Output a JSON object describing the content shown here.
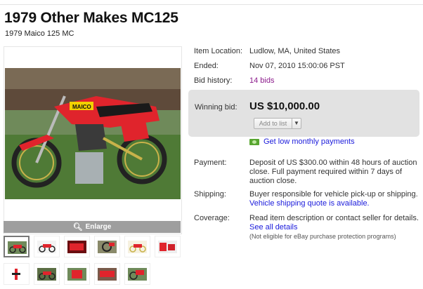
{
  "header": {
    "title": "1979 Other Makes MC125",
    "subtitle": "1979 Maico 125 MC"
  },
  "gallery": {
    "enlarge_label": "Enlarge",
    "thumbnail_count": 11
  },
  "details": {
    "item_location": {
      "label": "Item Location:",
      "value": "Ludlow, MA, United States"
    },
    "ended": {
      "label": "Ended:",
      "value": "Nov 07, 2010 15:00:06 PST"
    },
    "bid_history": {
      "label": "Bid history:",
      "value": "14 bids"
    },
    "winning_bid": {
      "label": "Winning bid:",
      "value": "US $10,000.00"
    },
    "add_to_list": "Add to list",
    "monthly_payments": "Get low monthly payments",
    "payment": {
      "label": "Payment:",
      "line1": "Deposit of US $300.00 within 48 hours of auction",
      "line2": "close. Full payment required within 7 days of",
      "line3": "auction close."
    },
    "shipping": {
      "label": "Shipping:",
      "line1": "Buyer responsible for vehicle pick-up or shipping.",
      "link": "Vehicle shipping quote is available."
    },
    "coverage": {
      "label": "Coverage:",
      "line1": "Read item description or contact seller for details.",
      "link": "See all details",
      "note": "(Not eligible for eBay purchase protection programs)"
    }
  },
  "colors": {
    "link": "#1a1adb",
    "bids_link": "#8b1a8b",
    "winning_box": "#e2e2e2",
    "bike_red": "#e0242c"
  },
  "icons": [
    "magnifier-icon",
    "money-icon",
    "chevron-down-icon"
  ]
}
